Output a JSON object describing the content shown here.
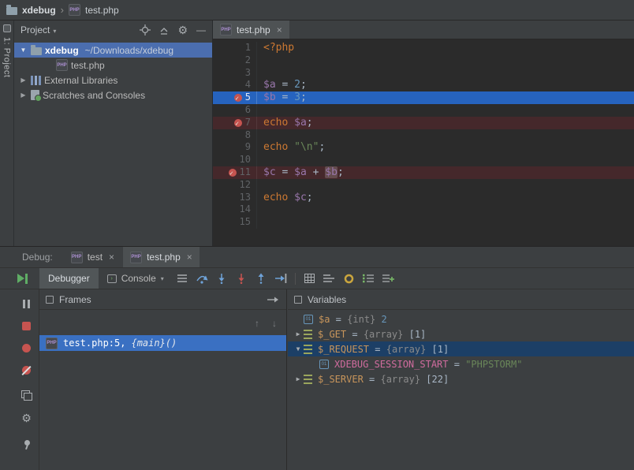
{
  "colors": {
    "panel_bg": "#3c3f41",
    "editor_bg": "#2b2b2b",
    "tree_selection_blue": "#4b6eaf",
    "execution_line_blue": "#2663be",
    "frame_selection_blue": "#3a70c2",
    "inactive_selection_navy": "#1c3f66",
    "breakpoint_line_red": "#45282b",
    "breakpoint_dot_red": "#c75450",
    "resume_green": "#5fad65",
    "keyword_orange": "#cc7832",
    "variable_purple": "#9876aa",
    "number_blue": "#6897bb",
    "string_green": "#6a8759",
    "debug_variable_orange": "#c8955b",
    "debug_key_pink": "#d06c9e"
  },
  "icons": {
    "chevron_expanded": "▼",
    "chevron_collapsed": "▶",
    "dropdown": "▾",
    "close": "×",
    "up_arrow": "↑",
    "down_arrow": "↓",
    "gear": "⚙",
    "minimize": "—"
  },
  "breadcrumb": {
    "project": "xdebug",
    "separator": "›",
    "file": "test.php"
  },
  "tool_stripe": {
    "project_button": "1: Project"
  },
  "project_panel": {
    "title": "Project",
    "tree": [
      {
        "label": "xdebug",
        "hint": "~/Downloads/xdebug",
        "icon": "folder",
        "chevron": "expanded",
        "selected": true,
        "indent": 0,
        "bold": true
      },
      {
        "label": "test.php",
        "icon": "php-file",
        "indent": 2
      },
      {
        "label": "External Libraries",
        "icon": "lib",
        "chevron": "collapsed",
        "indent": 0
      },
      {
        "label": "Scratches and Consoles",
        "icon": "scratch",
        "chevron": "collapsed",
        "indent": 0
      }
    ]
  },
  "editor": {
    "tab": {
      "label": "test.php",
      "close": "×"
    },
    "lines": [
      {
        "n": "1",
        "tokens": [
          {
            "c": "php",
            "t": "<?php"
          }
        ]
      },
      {
        "n": "2",
        "tokens": []
      },
      {
        "n": "3",
        "tokens": []
      },
      {
        "n": "4",
        "tokens": [
          {
            "c": "var",
            "t": "$a"
          },
          {
            "c": "plain",
            "t": " = "
          },
          {
            "c": "num",
            "t": "2"
          },
          {
            "c": "plain",
            "t": ";"
          }
        ]
      },
      {
        "n": "5",
        "bg": "exec",
        "bp": true,
        "tokens": [
          {
            "c": "var",
            "t": "$b"
          },
          {
            "c": "plain",
            "t": " = "
          },
          {
            "c": "num",
            "t": "3"
          },
          {
            "c": "plain",
            "t": ";"
          }
        ]
      },
      {
        "n": "6",
        "tokens": []
      },
      {
        "n": "7",
        "bg": "bp",
        "bp": true,
        "tokens": [
          {
            "c": "kw",
            "t": "echo "
          },
          {
            "c": "var",
            "t": "$a"
          },
          {
            "c": "plain",
            "t": ";"
          }
        ]
      },
      {
        "n": "8",
        "tokens": []
      },
      {
        "n": "9",
        "tokens": [
          {
            "c": "kw",
            "t": "echo "
          },
          {
            "c": "str",
            "t": "\"\\n\""
          },
          {
            "c": "plain",
            "t": ";"
          }
        ]
      },
      {
        "n": "10",
        "tokens": []
      },
      {
        "n": "11",
        "bg": "bp",
        "bp": true,
        "tokens": [
          {
            "c": "var",
            "t": "$c"
          },
          {
            "c": "plain",
            "t": " = "
          },
          {
            "c": "var",
            "t": "$a"
          },
          {
            "c": "plain",
            "t": " + "
          },
          {
            "c": "var boxed",
            "t": "$b"
          },
          {
            "c": "plain",
            "t": ";"
          }
        ]
      },
      {
        "n": "12",
        "tokens": []
      },
      {
        "n": "13",
        "tokens": [
          {
            "c": "kw",
            "t": "echo "
          },
          {
            "c": "var",
            "t": "$c"
          },
          {
            "c": "plain",
            "t": ";"
          }
        ]
      },
      {
        "n": "14",
        "tokens": []
      },
      {
        "n": "15",
        "tokens": []
      }
    ]
  },
  "debug": {
    "label": "Debug:",
    "session_tabs": [
      {
        "label": "test",
        "close": "×",
        "active": false
      },
      {
        "label": "test.php",
        "close": "×",
        "active": true
      }
    ],
    "view_tabs": [
      {
        "label": "Debugger",
        "active": true
      },
      {
        "label": "Console",
        "active": false,
        "has_icon": true
      }
    ],
    "frames": {
      "title": "Frames",
      "items": [
        {
          "file": "test.php:5, ",
          "fn": "{main}()",
          "selected": true
        }
      ]
    },
    "variables": {
      "title": "Variables",
      "rows": [
        {
          "chevron": "",
          "icon": "primitive",
          "name": "$a",
          "name_class": "vname",
          "eq": " = ",
          "type": "{int} ",
          "value": "2",
          "value_class": "num",
          "indent": 0
        },
        {
          "chevron": "collapsed",
          "icon": "array",
          "name": "$_GET",
          "name_class": "vname",
          "eq": " = ",
          "type": "{array} ",
          "value": "[1]",
          "value_class": "plain",
          "indent": 0
        },
        {
          "chevron": "expanded",
          "icon": "array",
          "name": "$_REQUEST",
          "name_class": "vname",
          "eq": " = ",
          "type": "{array} ",
          "value": "[1]",
          "value_class": "plain",
          "indent": 0,
          "selected": true
        },
        {
          "chevron": "",
          "icon": "primitive",
          "name": "XDEBUG_SESSION_START",
          "name_class": "keyname",
          "eq": " = ",
          "type": "",
          "value": "\"PHPSTORM\"",
          "value_class": "str",
          "indent": 1
        },
        {
          "chevron": "collapsed",
          "icon": "array",
          "name": "$_SERVER",
          "name_class": "vname",
          "eq": " = ",
          "type": "{array} ",
          "value": "[22]",
          "value_class": "plain",
          "indent": 0
        }
      ]
    }
  }
}
